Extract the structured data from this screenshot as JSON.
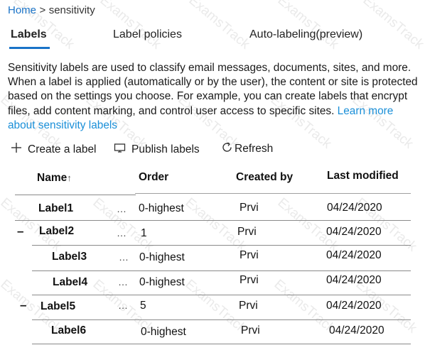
{
  "breadcrumb": {
    "home": "Home",
    "separator": ">",
    "current": "sensitivity"
  },
  "tabs": [
    {
      "label": "Labels",
      "active": true
    },
    {
      "label": "Label policies",
      "active": false
    },
    {
      "label": "Auto-labeling(preview)",
      "active": false
    }
  ],
  "description": {
    "text": "Sensitivity labels are used to classify email messages, documents, sites, and more. When a label is applied (automatically or by the user), the content or site is protected based on the settings you choose. For example, you can create labels that encrypt files, add content marking, and control user access to specific sites.",
    "link": "Learn more about sensitivity labels"
  },
  "toolbar": {
    "create": {
      "label": "Create a label",
      "icon": "plus-icon"
    },
    "publish": {
      "label": "Publish labels",
      "icon": "publish-icon"
    },
    "refresh": {
      "label": "Refresh",
      "icon": "refresh-icon"
    }
  },
  "table": {
    "columns": {
      "name": "Name",
      "sort_glyph": "↑",
      "order": "Order",
      "created_by": "Created by",
      "last_modified": "Last modified"
    },
    "more_glyph": "…",
    "collapse_glyph": "–",
    "rows": [
      {
        "name": "Label1",
        "order": "0-highest",
        "created_by": "Prvi",
        "last_modified": "04/24/2020"
      },
      {
        "name": "Label2",
        "order": "1",
        "created_by": "Prvi",
        "last_modified": "04/24/2020"
      },
      {
        "name": "Label3",
        "order": "0-highest",
        "created_by": "Prvi",
        "last_modified": "04/24/2020"
      },
      {
        "name": "Label4",
        "order": "0-highest",
        "created_by": "Prvi",
        "last_modified": "04/24/2020"
      },
      {
        "name": "Label5",
        "order": "5",
        "created_by": "Prvi",
        "last_modified": "04/24/2020"
      },
      {
        "name": "Label6",
        "order": "0-highest",
        "created_by": "Prvi",
        "last_modified": "04/24/2020"
      }
    ]
  },
  "watermark": "ExamsTrack"
}
